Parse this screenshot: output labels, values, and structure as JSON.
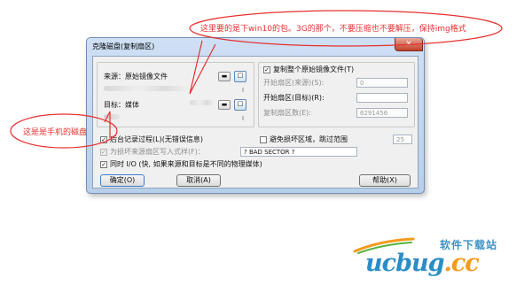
{
  "annotations": {
    "top_note": "这里要的是下win10的包。3G的那个，不要压缩也不要解压，保持img格式",
    "left_note": "这是是手机的磁盘"
  },
  "dialog": {
    "title": "克隆磁盘(复制扇区)",
    "close_glyph": "✕",
    "source_label": "来源：原始镜像文件",
    "target_label": "目标：媒体",
    "source_drop_glyph": "▬",
    "source_browse_glyph": "□",
    "target_drop_glyph": "▬",
    "target_browse_glyph": "□",
    "source_side_mark": "I",
    "target_side_mark": "I",
    "copy_whole_image_label": "复制整个原始镜像文件(T)",
    "copy_whole_image_checked": true,
    "start_sector_source_label": "开始扇区(来源)(S):",
    "start_sector_source_value": "0",
    "start_sector_target_label": "开始扇区(目标)(R):",
    "start_sector_target_value": "",
    "sector_count_label": "复制扇区数(E):",
    "sector_count_value": "6291456",
    "log_process_label": "后台记录过程(L)(无错误信息)",
    "log_process_checked": true,
    "avoid_bad_label": "避免损坏区域，跳过范围",
    "avoid_bad_value": "25",
    "replace_bad_label": "为损坏来源扇区写入式样(F)：",
    "replace_bad_value": "? BAD SECTOR ?",
    "simultaneous_io_label": "同时 I/O (快, 如果来源和目标是不同的物理媒体)",
    "simultaneous_io_checked": true,
    "ok_label": "确定(O)",
    "cancel_label": "取消(A)",
    "help_label": "帮助(X)"
  },
  "watermark": {
    "cn": "软件下载站",
    "en_prefix": "ucbug",
    "en_suffix": ".cc"
  },
  "colors": {
    "annotation": "#e53030",
    "watermark_blue": "#2a8dc7",
    "watermark_orange": "#f39a1c",
    "watermark_green": "#55b43a"
  }
}
